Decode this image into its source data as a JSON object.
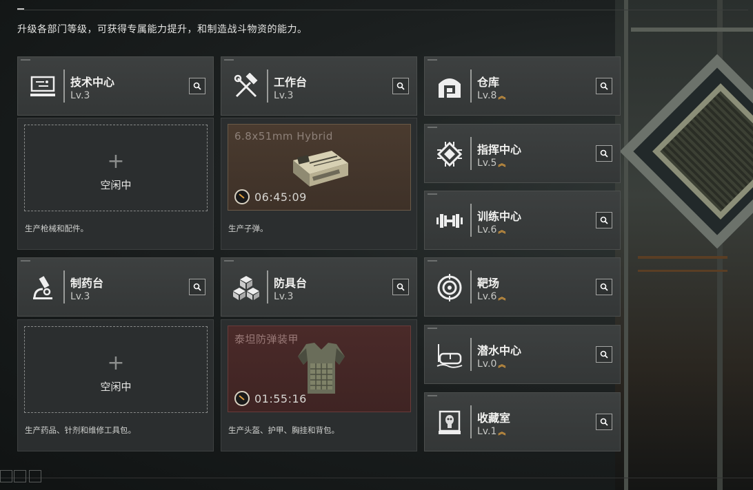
{
  "subtitle": "升级各部门等级，可获得专属能力提升，和制造战斗物资的能力。",
  "colors": {
    "accent": "#e0a040",
    "card_bg": "#3a3d3d",
    "ammo_bg": "#4a3b2f",
    "armor_bg": "#4a2a29"
  },
  "left_grid": {
    "tech_center": {
      "name": "技术中心",
      "level": "Lv.3",
      "icon": "computer-icon",
      "status": "idle",
      "plus": "+",
      "idle_label": "空闲中",
      "desc": "生产枪械和配件。"
    },
    "workbench": {
      "name": "工作台",
      "level": "Lv.3",
      "icon": "hammer-wrench-icon",
      "status": "producing",
      "product": "6.8x51mm Hybrid",
      "timer": "06:45:09",
      "desc": "生产子弹。"
    },
    "pharmacy": {
      "name": "制药台",
      "level": "Lv.3",
      "icon": "microscope-icon",
      "status": "idle",
      "plus": "+",
      "idle_label": "空闲中",
      "desc": "生产药品、针剂和维修工具包。"
    },
    "armory": {
      "name": "防具台",
      "level": "Lv.3",
      "icon": "cubes-icon",
      "status": "producing",
      "product": "泰坦防弹装甲",
      "timer": "01:55:16",
      "desc": "生产头盔、护甲、胸挂和背包。"
    }
  },
  "right_list": [
    {
      "name": "仓库",
      "level": "Lv.8",
      "icon": "warehouse-icon",
      "upgradable": true
    },
    {
      "name": "指挥中心",
      "level": "Lv.5",
      "icon": "chip-icon",
      "upgradable": true
    },
    {
      "name": "训练中心",
      "level": "Lv.6",
      "icon": "dumbbell-icon",
      "upgradable": true
    },
    {
      "name": "靶场",
      "level": "Lv.6",
      "icon": "target-icon",
      "upgradable": true
    },
    {
      "name": "潜水中心",
      "level": "Lv.0",
      "icon": "diving-mask-icon",
      "upgradable": true
    },
    {
      "name": "收藏室",
      "level": "Lv.1",
      "icon": "display-case-icon",
      "upgradable": true
    }
  ]
}
